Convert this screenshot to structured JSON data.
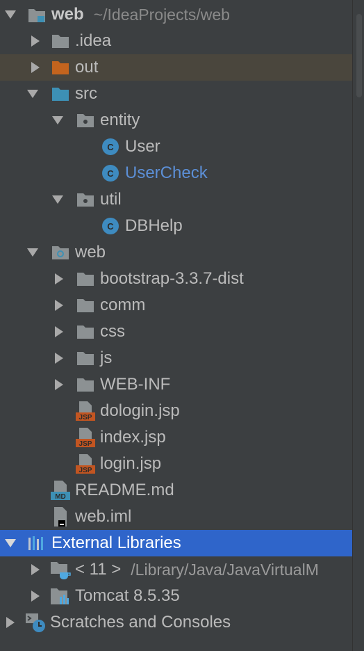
{
  "tree": {
    "root": {
      "label": "web",
      "path": "~/IdeaProjects/web"
    },
    "idea": "/.idea",
    "out": "out",
    "src": "src",
    "entity": "entity",
    "user": "User",
    "user_check": "UserCheck",
    "util": "util",
    "dbhelp": "DBHelp",
    "web": "web",
    "bootstrap": "bootstrap-3.3.7-dist",
    "comm": "comm",
    "css": "css",
    "js": "js",
    "web_inf": "WEB-INF",
    "dologin": "dologin.jsp",
    "index": "index.jsp",
    "login": "login.jsp",
    "readme": "README.md",
    "web_iml": "web.iml",
    "external_libraries": "External Libraries",
    "jdk": {
      "label": "< 11 >",
      "path": "/Library/Java/JavaVirtualM"
    },
    "tomcat": "Tomcat 8.5.35",
    "scratches": "Scratches and Consoles",
    "idea_label": ".idea"
  },
  "icons": {
    "folder": "folder-icon",
    "source_folder": "source-folder-icon",
    "package": "package-icon",
    "class": "class-icon",
    "jsp": "jsp-file-icon",
    "markdown": "markdown-file-icon",
    "iml": "iml-file-icon",
    "libraries": "libraries-icon",
    "jdk": "jdk-icon",
    "tomcat": "tomcat-icon",
    "scratches": "scratches-icon"
  },
  "colors": {
    "background": "#3c3f41",
    "selected_row": "#2f65ca",
    "excluded_row": "#4a463d",
    "folder_gray": "#8c9193",
    "folder_blue": "#3d90b5",
    "folder_orange": "#c3641e",
    "class_blue": "#3e8bc0",
    "jsp_orange": "#c25521"
  }
}
